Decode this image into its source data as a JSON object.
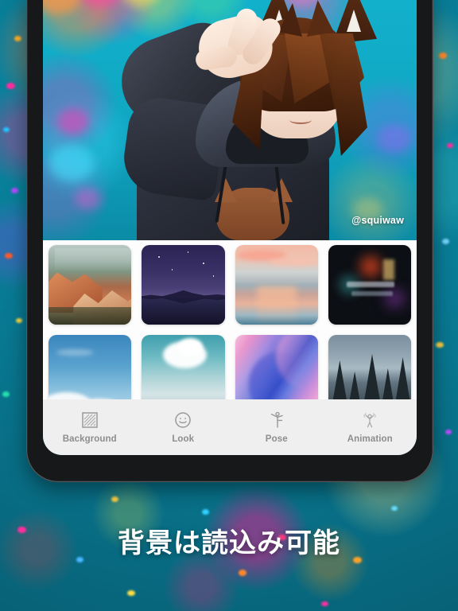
{
  "promo": {
    "caption": "背景は読込み可能",
    "background_color": "#0d7d96"
  },
  "app": {
    "stage": {
      "watermark": "@squiwaw",
      "avatar_description": "anime avatar with brown hair and cat ears making a peace sign"
    },
    "background_picker": {
      "thumbnails": [
        {
          "name": "canyon-landscape"
        },
        {
          "name": "starry-night-lake"
        },
        {
          "name": "sunset-ocean"
        },
        {
          "name": "dark-neon-city"
        },
        {
          "name": "blue-sky-clouds"
        },
        {
          "name": "teal-sky-cloud"
        },
        {
          "name": "pink-blue-marble"
        },
        {
          "name": "snowy-forest"
        }
      ]
    },
    "tabbar": {
      "items": [
        {
          "label": "Background",
          "icon": "checker-square-icon",
          "selected": true
        },
        {
          "label": "Look",
          "icon": "smiley-face-icon",
          "selected": false
        },
        {
          "label": "Pose",
          "icon": "stick-figure-pose-icon",
          "selected": false
        },
        {
          "label": "Animation",
          "icon": "stick-figure-animation-icon",
          "selected": false
        }
      ]
    }
  }
}
